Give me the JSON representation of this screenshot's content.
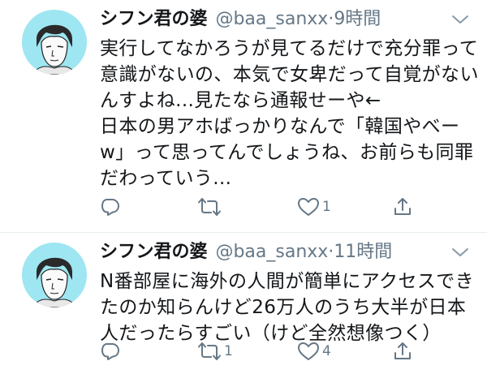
{
  "tweets": [
    {
      "name": "シフン君の婆",
      "handle": "@baa_sanxx",
      "dot": "·",
      "time": "9時間",
      "lines": [
        "実行してなかろうが見てるだけで充分罪って",
        "意識がないの、本気で女卑だって自覚がない",
        "んすよね...見たなら通報せーや←",
        "日本の男アホばっかりなんで「韓国やべー",
        "w」って思ってんでしょうね、お前らも同罪",
        "だわっていう..."
      ],
      "reply_count": "",
      "retweet_count": "",
      "like_count": "1"
    },
    {
      "name": "シフン君の婆",
      "handle": "@baa_sanxx",
      "dot": "·",
      "time": "11時間",
      "lines": [
        "N番部屋に海外の人間が簡単にアクセスでき",
        "たのか知らんけど26万人のうち大半が日本",
        "人だったらすごい（けど全然想像つく）"
      ],
      "reply_count": "",
      "retweet_count": "1",
      "like_count": "4"
    }
  ],
  "icons": {
    "reply": "reply-icon",
    "retweet": "retweet-icon",
    "like": "heart-icon",
    "share": "share-icon",
    "more": "chevron-down-icon",
    "avatar": "avatar"
  },
  "colors": {
    "text": "#14171a",
    "muted": "#657786",
    "avatar_bg": "#9ee6f2",
    "divider": "#e6ecf0"
  }
}
